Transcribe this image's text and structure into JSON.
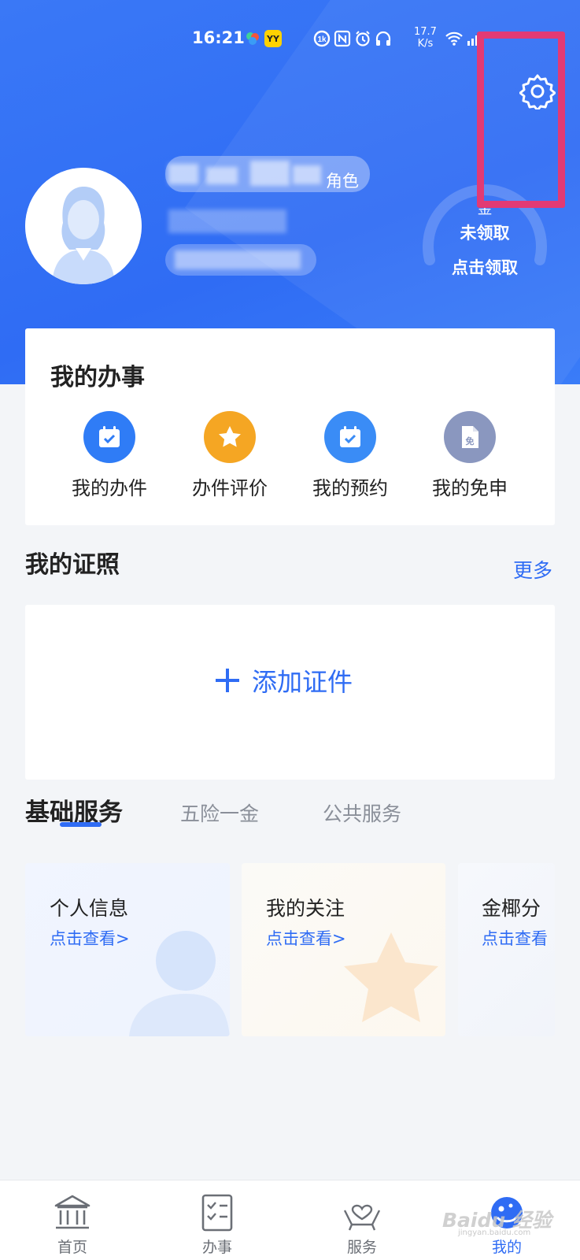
{
  "status_bar": {
    "time": "16:21",
    "app_badge_1": "YY",
    "net_speed_value": "17.7",
    "net_speed_unit": "K/s"
  },
  "profile": {
    "role_label": "角色",
    "reward": {
      "prefix": "金",
      "status": "未领取",
      "action": "点击领取"
    }
  },
  "my_affairs": {
    "title": "我的办事",
    "items": [
      {
        "label": "我的办件",
        "icon": "calendar-check-icon",
        "color": "#2f7cf6"
      },
      {
        "label": "办件评价",
        "icon": "star-icon",
        "color": "#f5a623"
      },
      {
        "label": "我的预约",
        "icon": "calendar-check-icon",
        "color": "#3a8cf6"
      },
      {
        "label": "我的免申",
        "icon": "document-exempt-icon",
        "color": "#8a97bf"
      }
    ]
  },
  "certificates": {
    "title": "我的证照",
    "more": "更多",
    "add_label": "添加证件"
  },
  "service_tabs": {
    "tabs": [
      "基础服务",
      "五险一金",
      "公共服务"
    ],
    "active_index": 0
  },
  "service_cards": [
    {
      "title": "个人信息",
      "link": "点击查看>",
      "icon": "person-icon"
    },
    {
      "title": "我的关注",
      "link": "点击查看>",
      "icon": "star-icon"
    },
    {
      "title": "金椰分",
      "link": "点击查看",
      "icon": "coin-icon"
    }
  ],
  "bottom_nav": {
    "items": [
      {
        "label": "首页",
        "icon": "building-icon"
      },
      {
        "label": "办事",
        "icon": "checklist-icon"
      },
      {
        "label": "服务",
        "icon": "hand-heart-icon"
      },
      {
        "label": "我的",
        "icon": "profile-icon"
      }
    ],
    "active_index": 3
  },
  "watermark": {
    "brand": "Baidu 经验",
    "url": "jingyan.baidu.com"
  },
  "colors": {
    "brand_blue": "#2f6cf4",
    "highlight": "#e23a74"
  }
}
